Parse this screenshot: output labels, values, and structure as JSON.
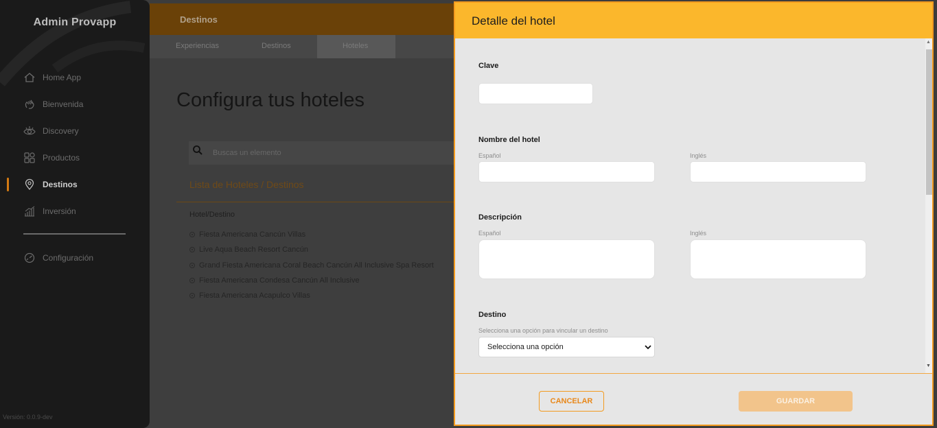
{
  "sidebar": {
    "brand": "Admin Provapp",
    "items": [
      {
        "label": "Home App",
        "icon": "home-icon"
      },
      {
        "label": "Bienvenida",
        "icon": "hand-wave-icon"
      },
      {
        "label": "Discovery",
        "icon": "eye-icon"
      },
      {
        "label": "Productos",
        "icon": "grid-icon"
      },
      {
        "label": "Destinos",
        "icon": "location-pin-icon",
        "active": true
      },
      {
        "label": "Inversión",
        "icon": "chart-bar-icon"
      }
    ],
    "settings": {
      "label": "Configuración",
      "icon": "gauge-icon"
    },
    "version": "Versión: 0.0.9-dev"
  },
  "topbar": {
    "title": "Destinos"
  },
  "tabs": [
    {
      "label": "Experiencias"
    },
    {
      "label": "Destinos"
    },
    {
      "label": "Hoteles",
      "active": true
    }
  ],
  "main": {
    "title": "Configura tus hoteles",
    "search_placeholder": "Buscas un elemento",
    "list_title": "Lista de Hoteles / Destinos",
    "column_header": "Hotel/Destino",
    "rows": [
      "Fiesta Americana Cancún Villas",
      "Live Aqua Beach Resort Cancún",
      "Grand Fiesta Americana Coral Beach Cancún All Inclusive Spa Resort",
      "Fiesta Americana Condesa Cancún All Inclusive",
      "Fiesta Americana Acapulco Villas"
    ]
  },
  "modal": {
    "title": "Detalle del hotel",
    "clave_label": "Clave",
    "clave_value": "",
    "nombre_label": "Nombre del hotel",
    "descripcion_label": "Descripción",
    "spanish": "Español",
    "english": "Inglés",
    "destino_label": "Destino",
    "destino_help": "Selecciona una opción para vincular un destino",
    "destino_selected": "Selecciona una opción",
    "cancel_label": "CANCELAR",
    "save_label": "GUARDAR"
  },
  "colors": {
    "accent": "#f39a1e",
    "header": "#fbb72c",
    "save_disabled": "#f2c48b"
  }
}
